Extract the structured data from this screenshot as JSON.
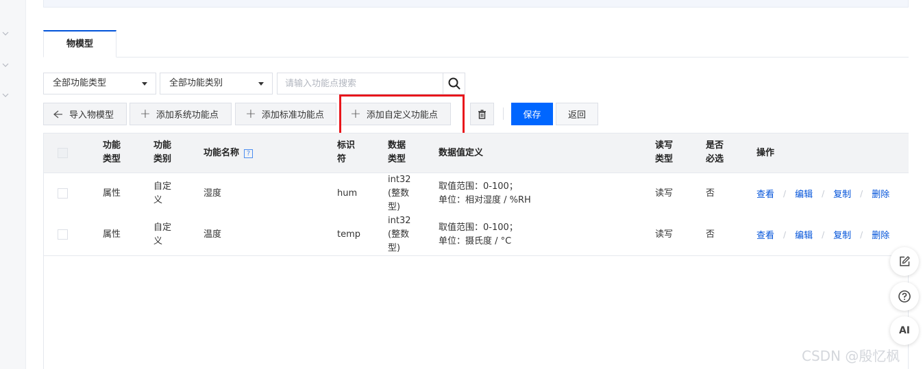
{
  "tabs": [
    {
      "label": "物模型"
    }
  ],
  "filters": {
    "function_type": "全部功能类型",
    "function_category": "全部功能类别",
    "search_placeholder": "请输入功能点搜索"
  },
  "toolbar": {
    "import": "导入物模型",
    "add_system": "添加系统功能点",
    "add_standard": "添加标准功能点",
    "add_custom": "添加自定义功能点",
    "save": "保存",
    "back": "返回"
  },
  "table": {
    "headers": {
      "type": [
        "功能",
        "类型"
      ],
      "category": [
        "功能",
        "类别"
      ],
      "name": "功能名称",
      "identifier": [
        "标识",
        "符"
      ],
      "data_type": [
        "数据",
        "类型"
      ],
      "definition": "数据值定义",
      "rw": [
        "读写",
        "类型"
      ],
      "required": [
        "是否",
        "必选"
      ],
      "actions": "操作"
    },
    "rows": [
      {
        "type": "属性",
        "category": [
          "自定",
          "义"
        ],
        "name": "湿度",
        "identifier": "hum",
        "data_type": [
          "int32",
          "(整数",
          "型)"
        ],
        "definition": [
          "取值范围：0-100；",
          "单位：相对湿度 / %RH"
        ],
        "rw": "读写",
        "required": "否",
        "actions": [
          "查看",
          "编辑",
          "复制",
          "删除"
        ]
      },
      {
        "type": "属性",
        "category": [
          "自定",
          "义"
        ],
        "name": "温度",
        "identifier": "temp",
        "data_type": [
          "int32",
          "(整数",
          "型)"
        ],
        "definition": [
          "取值范围：0-100；",
          "单位：摄氏度 / °C"
        ],
        "rw": "读写",
        "required": "否",
        "actions": [
          "查看",
          "编辑",
          "复制",
          "删除"
        ]
      }
    ]
  },
  "float_buttons": [
    {
      "icon": "edit-icon"
    },
    {
      "icon": "help-circle-icon"
    },
    {
      "label": "AI"
    }
  ],
  "watermark": "CSDN @殷忆枫",
  "highlight_color": "#e8161b",
  "primary_color": "#0066ff"
}
